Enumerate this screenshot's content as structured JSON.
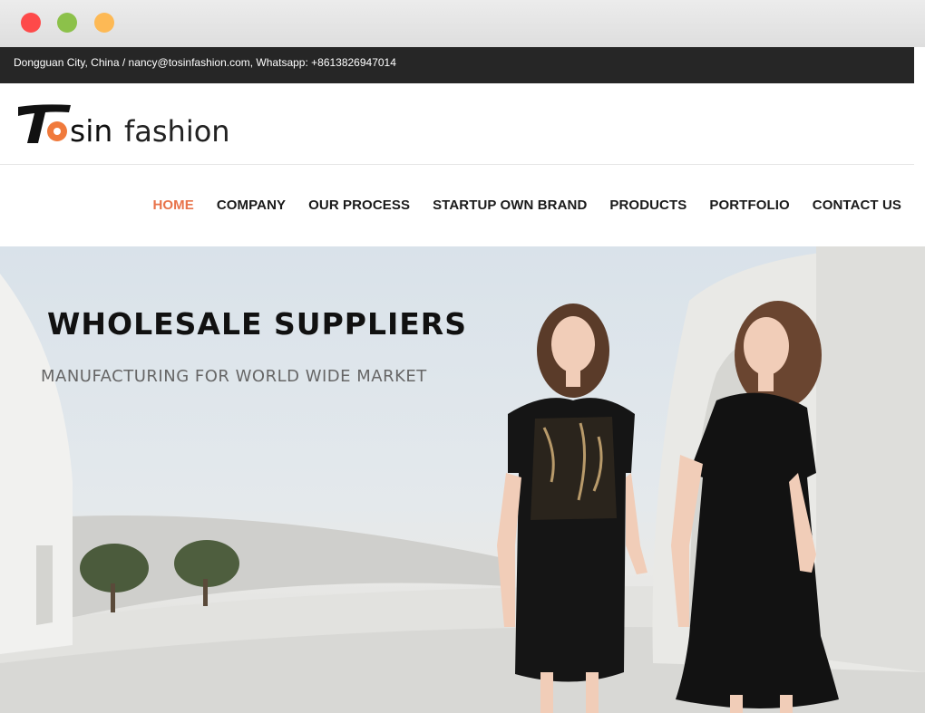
{
  "window": {
    "controls": [
      {
        "name": "close",
        "color": "#fe4a4a"
      },
      {
        "name": "minimize",
        "color": "#8cc14a"
      },
      {
        "name": "maximize",
        "color": "#fdb955"
      }
    ]
  },
  "topbar": {
    "contact_text": "Dongguan City, China / nancy@tosinfashion.com, Whatsapp: +8613826947014"
  },
  "header": {
    "logo_text_bold": "T",
    "logo_text_o": "o",
    "logo_text_sin": "sin",
    "logo_text_fashion": "fashion"
  },
  "nav": {
    "items": [
      {
        "label": "HOME",
        "active": true
      },
      {
        "label": "COMPANY"
      },
      {
        "label": "OUR PROCESS"
      },
      {
        "label": "STARTUP OWN BRAND"
      },
      {
        "label": "PRODUCTS"
      },
      {
        "label": "PORTFOLIO"
      },
      {
        "label": "CONTACT US"
      }
    ]
  },
  "hero": {
    "title": "WHOLESALE SUPPLIERS",
    "subtitle": "MANUFACTURING FOR WORLD WIDE MARKET"
  },
  "colors": {
    "accent": "#e8734a",
    "topbar_bg": "#262626",
    "text_dark": "#1a1a1a"
  }
}
